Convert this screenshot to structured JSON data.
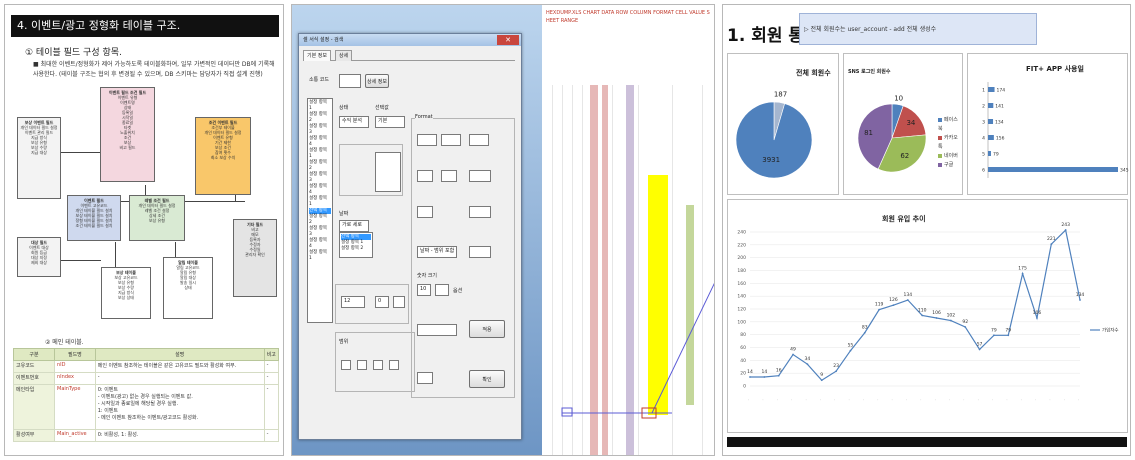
{
  "panel1": {
    "title": "4. 이벤트/광고 정형화 테이블 구조.",
    "subtitle": "① 테이블 필드 구성 항목.",
    "body": "■ 최대한 이벤트/정형화가 제어 가능하도록 테이블화하여, 일부 가변적인 데이터만 DB에 기록해 사용한다. (테이블 구조는 협의 후 변경될 수 있으며, DB 스키마는 담당자가 직접 설계 진행)",
    "boxes": [
      {
        "head": "이벤트 필드 조건 필드",
        "body": "이벤트 유형\n이벤트명\n상태\n등록일\n시작일\n종료일\n타겟\n노출위치\n조건\n보상\n비고 필드"
      },
      {
        "head": "조건 이벤트 필드",
        "body": "조건부 테이블\n개인 데이터 필드 설정\n이벤트 유형\n기간 제한\n보상 조건\n참여 횟수\n최소 보상 수치"
      },
      {
        "head": "보상 이벤트 필드",
        "body": "개인 데이터 필드 설정\n이벤트 관리 필드\n지급 방식\n보상 유형\n보상 수량\n지급 대상"
      },
      {
        "head": "이벤트 필드",
        "body": "이벤트 고유코드\n개인 테이블 필드 설치\n보상 테이블 필드 설치\n정형 테이블 필드 설치\n조건 테이블 필드 설치"
      },
      {
        "head": "레벨 조건 필드",
        "body": "개인 데이터 필드 설정\n레벨 조건 설정\n상세 조건\n보상 유형"
      },
      {
        "head": "대상 필드",
        "body": "이벤트 대상\n회원 등급\n대상 지정\n제외 대상"
      },
      {
        "head": "보상 테이블",
        "body": "보상 고유코드\n보상 유형\n보상 수량\n지급 방식\n보상 상태"
      },
      {
        "head": "알림 테이블",
        "body": "알림 고유코드\n알림 유형\n알림 대상\n발송 일시\n상태"
      },
      {
        "head": "기타 필드",
        "body": "비고\n메모\n등록자\n수정자\n수정일\n관리자 확인"
      }
    ],
    "section": "② 메인 테이블.",
    "table": {
      "headers": [
        "구분",
        "필드명",
        "설명",
        "비고"
      ],
      "rows": [
        {
          "k": "고유코드",
          "field": "nID",
          "desc": "메인 이벤트 참조하는 테이블은 같은 고유코드 필드와 활성화 여부.",
          "note": "-"
        },
        {
          "k": "이벤트번호",
          "field": "nIndex",
          "desc": "-",
          "note": "-"
        },
        {
          "k": "메인타입",
          "field": "MainType",
          "desc": "0: 이벤트\n - 이벤트(광고) 없는 경우 실행되는 이벤트 값.\n - 시작일과 종료일에 해당될 경우 실행.\n1: 이벤트\n - 메인 이벤트 참조하는 이벤트/광고코드 활성화.",
          "note": "-"
        },
        {
          "k": "활성여부",
          "field": "Main_active",
          "desc": "0: 비활성, 1: 활성.",
          "note": "-"
        }
      ]
    }
  },
  "panel2": {
    "dialog_title": "셀 서식 설정 - 검색",
    "tabs": [
      "기본 정보",
      "상세"
    ],
    "labels": {
      "field1": "소통 코드",
      "field2": "상세 정보",
      "group_format": "Format",
      "status": "상태",
      "select_label": "선택값",
      "date": "날짜",
      "number_size": "숫자 크기",
      "range": "범위",
      "options": "옵션",
      "apply": "적용",
      "ok": "확인",
      "cancel": "취소",
      "close": "✕"
    },
    "values": {
      "v1": "수익 분석",
      "v2": "기본",
      "v3": "가로 세로",
      "v4": "12",
      "v5": "0",
      "v6": "날짜 - 범위 포함",
      "v7": "10"
    },
    "list_options": [
      "설정 항목 1",
      "설정 항목 2",
      "설정 항목 3",
      "설정 항목 4",
      "선택 항목"
    ],
    "sheet_text": "HEXDUMP.XLS CHART DATA ROW COLUMN FORMAT CELL VALUE SHEET RANGE"
  },
  "panel3": {
    "title": "1. 회원 통계",
    "note": "▷ 전체 회원수는 user_account - add 전체 생성수",
    "pie1": {
      "title": "전체 회원수",
      "labels": [
        "187",
        "3931"
      ]
    },
    "pie2": {
      "title": "SNS 로그인 회원수",
      "labels": [
        "10",
        "34",
        "62",
        "81"
      ],
      "legend": [
        "페이스북",
        "카카오톡",
        "네이버",
        "구글",
        "애플"
      ]
    },
    "barchart": {
      "title": "FIT+ APP 사용일",
      "categories": [
        "1",
        "2",
        "3",
        "4",
        "5",
        "6"
      ],
      "values": [
        174,
        141,
        134,
        156,
        79,
        3457
      ],
      "value_labels": [
        "174",
        "141",
        "134",
        "156",
        "79",
        "3457"
      ]
    },
    "linechart": {
      "title": "회원 유입 추이",
      "legend": "가입자수",
      "y_ticks": [
        "0",
        "20",
        "40",
        "60",
        "80",
        "100",
        "120",
        "140",
        "160",
        "180",
        "200",
        "220",
        "240"
      ]
    }
  },
  "chart_data": [
    {
      "type": "pie",
      "title": "전체 회원수",
      "values": [
        187,
        3931
      ]
    },
    {
      "type": "pie",
      "title": "SNS 로그인 회원수",
      "values": [
        10,
        34,
        62,
        81
      ],
      "colors": [
        "#4f81bd",
        "#c0504d",
        "#9bbb59",
        "#8064a2"
      ]
    },
    {
      "type": "bar",
      "title": "FIT+ APP 사용일",
      "categories": [
        "1",
        "2",
        "3",
        "4",
        "5",
        "6"
      ],
      "values": [
        174,
        141,
        134,
        156,
        79,
        3457
      ]
    },
    {
      "type": "line",
      "title": "회원 유입 추이",
      "ylim": [
        0,
        240
      ],
      "series": [
        {
          "name": "가입자수",
          "values": [
            14,
            14,
            16,
            49,
            34,
            9,
            23,
            55,
            83,
            119,
            126,
            134,
            110,
            106,
            102,
            92,
            57,
            79,
            79,
            175,
            106,
            221,
            243,
            134
          ]
        }
      ],
      "point_labels": [
        "14",
        "14",
        "16",
        "49",
        "34",
        "9",
        "23",
        "55",
        "83",
        "119",
        "126",
        "134",
        "110",
        "106",
        "102",
        "92",
        "57",
        "79",
        "79",
        "175",
        "106",
        "221",
        "243",
        "134"
      ]
    }
  ],
  "colors": {
    "pie_blue": "#4f81bd",
    "pie_red": "#c0504d",
    "pie_green": "#9bbb59",
    "pie_purple": "#8064a2",
    "bar_blue": "#4f81bd",
    "line_blue": "#4f81bd",
    "highlight_yellow": "#ffff00",
    "col_pink": "#e6b8b7",
    "col_lavender": "#ccc0da",
    "col_olive": "#c4d79b"
  }
}
